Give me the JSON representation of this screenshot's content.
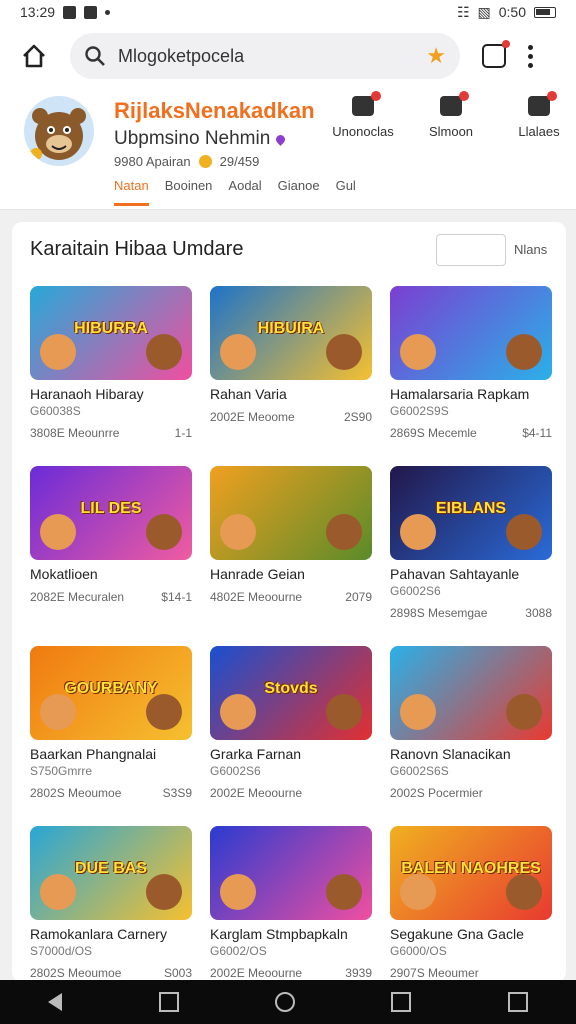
{
  "status_bar": {
    "time": "13:29",
    "battery_text": "0:50"
  },
  "browser": {
    "url": "Mlogoketpocela",
    "icons": [
      "home-icon",
      "search-icon",
      "star-icon",
      "tabs-icon",
      "more-vert-icon"
    ],
    "accent": "#f0a020"
  },
  "profile": {
    "name": "RijlaksNenakadkan",
    "subtitle": "Ubpmsino Nehmin",
    "stats_left": "9980 Apairan",
    "stats_right": "29/459",
    "actions": [
      {
        "label": "Unonoclas",
        "icon": "store-icon"
      },
      {
        "label": "Slmoon",
        "icon": "chat-icon"
      },
      {
        "label": "Llalaes",
        "icon": "cart-icon"
      }
    ],
    "tabs": [
      "Natan",
      "Booinen",
      "Aodal",
      "Gianoe",
      "Gul"
    ],
    "brand_color": "#f07020"
  },
  "section": {
    "title": "Karaitain Hibaa Umdare",
    "filter_label": "Nlans",
    "items": [
      {
        "banner": "HIBURRA",
        "title": "Haranaoh Hibaray",
        "sub": "G60038S",
        "date": "3808E Meounrre",
        "price": "1-1",
        "colors": [
          "#27a8d8",
          "#f04fa0"
        ]
      },
      {
        "banner": "HIBUIRA",
        "title": "Rahan Varia",
        "sub": "",
        "date": "2002E Meoome",
        "price": "2S90",
        "colors": [
          "#1d73c9",
          "#f6c030"
        ]
      },
      {
        "banner": "",
        "title": "Hamalarsaria Rapkam",
        "sub": "G6002S9S",
        "date": "2869S Mecemle",
        "price": "$4-11",
        "colors": [
          "#7b3fd1",
          "#2bb0e8"
        ]
      },
      {
        "banner": "LIL DES",
        "title": "Mokatlioen",
        "sub": "",
        "date": "2082E Mecuralen",
        "price": "$14-1",
        "colors": [
          "#6b2bd8",
          "#f05ca0"
        ]
      },
      {
        "banner": "",
        "title": "Hanrade Geian",
        "sub": "",
        "date": "4802E Meoourne",
        "price": "2079",
        "colors": [
          "#f0a020",
          "#5a8b2a"
        ]
      },
      {
        "banner": "EIBLANS",
        "title": "Pahavan Sahtayanle",
        "sub": "G6002S6",
        "date": "2898S Mesemgae",
        "price": "3088",
        "colors": [
          "#22174a",
          "#2a6bd8"
        ]
      },
      {
        "banner": "GOURBANY",
        "title": "Baarkan Phangnalai",
        "sub": "S750Gmrre",
        "date": "2802S Meoumoe",
        "price": "S3S9",
        "colors": [
          "#f07a10",
          "#f6c030"
        ]
      },
      {
        "banner": "Stovds",
        "title": "Grarka Farnan",
        "sub": "G6002S6",
        "date": "2002E Meoourne",
        "price": "",
        "colors": [
          "#1a4fd0",
          "#e23030"
        ]
      },
      {
        "banner": "",
        "title": "Ranovn Slanacikan",
        "sub": "G6002S6S",
        "date": "2002S Pocermier",
        "price": "",
        "colors": [
          "#2ab0e8",
          "#e83a30"
        ]
      },
      {
        "banner": "DUE BAS",
        "title": "Ramokanlara Carnery",
        "sub": "S7000d/OS",
        "date": "2802S Meoumoe",
        "price": "S003",
        "colors": [
          "#29a6d6",
          "#f6c030"
        ]
      },
      {
        "banner": "",
        "title": "Karglam Stmpbapkaln",
        "sub": "G6002/OS",
        "date": "2002E Meoourne",
        "price": "3939",
        "colors": [
          "#2a3bd0",
          "#f04fa0"
        ]
      },
      {
        "banner": "BALEN NAOHRES",
        "title": "Segakune Gna Gacle",
        "sub": "G6000/OS",
        "date": "2907S Meoumer",
        "price": "",
        "colors": [
          "#f0b020",
          "#e83a30"
        ]
      }
    ]
  }
}
